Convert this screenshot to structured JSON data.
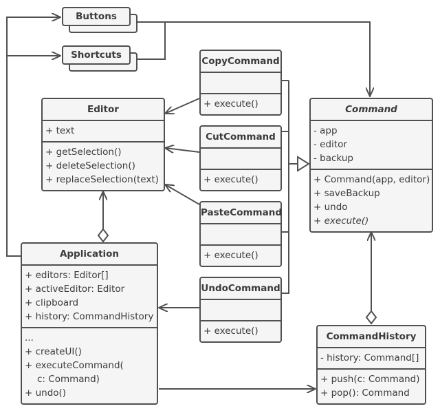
{
  "diagram": {
    "type": "UML class diagram",
    "pattern": "Command",
    "stroke_color": "#505050",
    "fill_color": "#f5f5f5",
    "text_color": "#3b3b3b"
  },
  "invokers": [
    {
      "name": "Buttons"
    },
    {
      "name": "Shortcuts"
    }
  ],
  "classes": {
    "editor": {
      "name": "Editor",
      "fields": [
        "+ text"
      ],
      "methods": [
        "+ getSelection()",
        "+ deleteSelection()",
        "+ replaceSelection(text)"
      ]
    },
    "application": {
      "name": "Application",
      "fields": [
        "+ editors: Editor[]",
        "+ activeEditor: Editor",
        "+ clipboard",
        "+ history: CommandHistory"
      ],
      "methods": [
        "...",
        "+ createUI()",
        "+ executeCommand(",
        "c: Command)",
        "+ undo()"
      ]
    },
    "copy": {
      "name": "CopyCommand",
      "methods": [
        "+ execute()"
      ]
    },
    "cut": {
      "name": "CutCommand",
      "methods": [
        "+ execute()"
      ]
    },
    "paste": {
      "name": "PasteCommand",
      "methods": [
        "+ execute()"
      ]
    },
    "undo": {
      "name": "UndoCommand",
      "methods": [
        "+ execute()"
      ]
    },
    "command": {
      "name": "Command",
      "abstract": true,
      "fields": [
        "- app",
        "- editor",
        "- backup"
      ],
      "methods": [
        "+ Command(app, editor)",
        "+ saveBackup",
        "+ undo"
      ],
      "abstract_methods": [
        "+ execute()"
      ]
    },
    "history": {
      "name": "CommandHistory",
      "fields": [
        "- history: Command[]"
      ],
      "methods": [
        "+ push(c: Command)",
        "+ pop(): Command"
      ]
    }
  },
  "relationships": [
    {
      "from": "Application",
      "to": "Buttons",
      "kind": "association"
    },
    {
      "from": "Application",
      "to": "Shortcuts",
      "kind": "association"
    },
    {
      "from": "Buttons",
      "to": "Command",
      "kind": "association"
    },
    {
      "from": "Shortcuts",
      "to": "Command",
      "kind": "association"
    },
    {
      "from": "CopyCommand",
      "to": "Editor",
      "kind": "association"
    },
    {
      "from": "CutCommand",
      "to": "Editor",
      "kind": "association"
    },
    {
      "from": "PasteCommand",
      "to": "Editor",
      "kind": "association"
    },
    {
      "from": "UndoCommand",
      "to": "Application",
      "kind": "association"
    },
    {
      "from": "CopyCommand",
      "to": "Command",
      "kind": "inheritance"
    },
    {
      "from": "CutCommand",
      "to": "Command",
      "kind": "inheritance"
    },
    {
      "from": "PasteCommand",
      "to": "Command",
      "kind": "inheritance"
    },
    {
      "from": "UndoCommand",
      "to": "Command",
      "kind": "inheritance"
    },
    {
      "from": "Application",
      "to": "Editor",
      "kind": "aggregation"
    },
    {
      "from": "CommandHistory",
      "to": "Command",
      "kind": "aggregation"
    },
    {
      "from": "Application",
      "to": "CommandHistory",
      "kind": "association"
    }
  ]
}
